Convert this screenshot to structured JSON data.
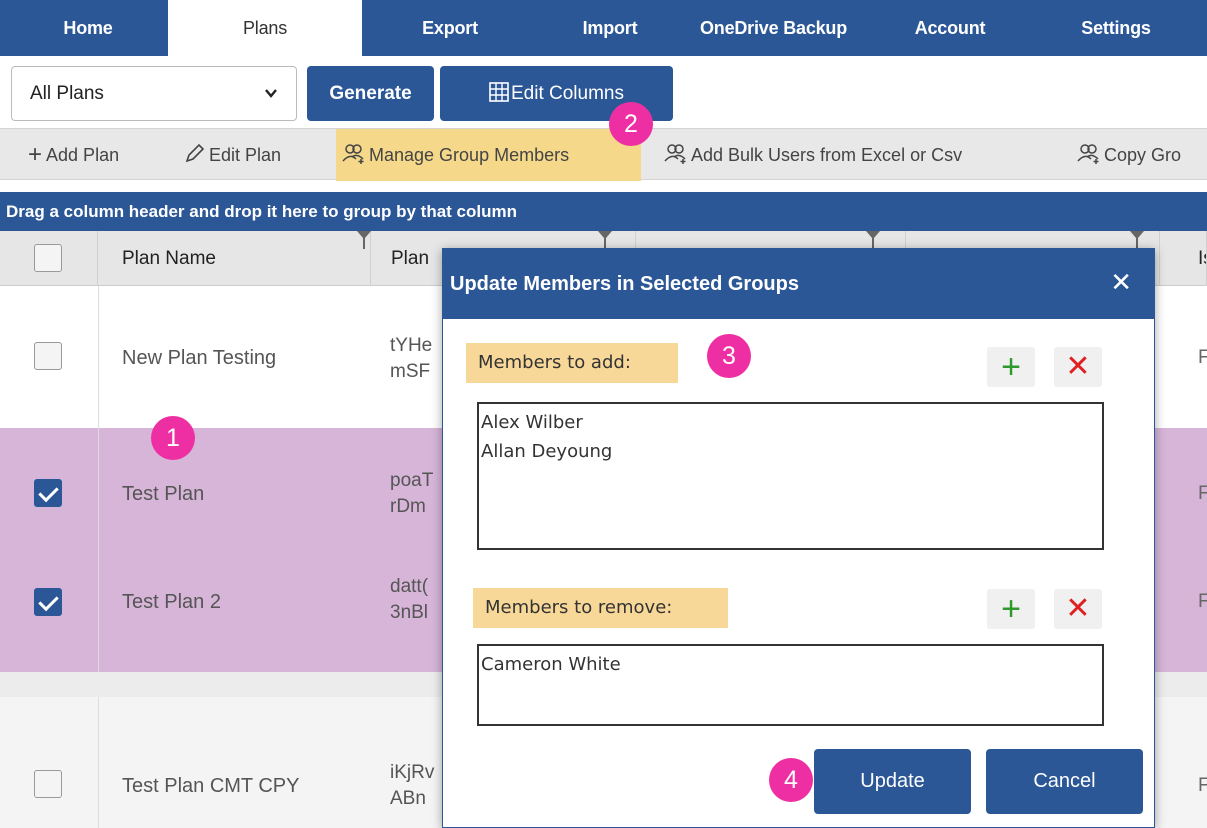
{
  "nav": {
    "tabs": [
      {
        "label": "Home"
      },
      {
        "label": "Plans"
      },
      {
        "label": "Export"
      },
      {
        "label": "Import"
      },
      {
        "label": "OneDrive Backup"
      },
      {
        "label": "Account"
      },
      {
        "label": "Settings"
      }
    ]
  },
  "toolbar": {
    "plan_filter": "All Plans",
    "generate": "Generate",
    "edit_columns": "Edit Columns"
  },
  "actions": {
    "add_plan": "Add Plan",
    "edit_plan": "Edit Plan",
    "manage_group_members": "Manage Group Members",
    "add_bulk_users": "Add Bulk Users from Excel or Csv",
    "copy_group": "Copy Gro"
  },
  "group_hint": "Drag a column header and drop it here to group by that column",
  "grid": {
    "columns": [
      "Plan Name",
      "Plan",
      "",
      "",
      "Is"
    ],
    "rows": [
      {
        "name": "New Plan Testing",
        "id_line1": "tYHe",
        "id_line2": "mSF",
        "last": "F",
        "checked": false
      },
      {
        "name": "Test Plan",
        "id_line1": "poaT",
        "id_line2": "rDm",
        "last": "F",
        "checked": true
      },
      {
        "name": "Test Plan 2",
        "id_line1": "datt(",
        "id_line2": "3nBl",
        "last": "F",
        "checked": true
      },
      {
        "name": "Test Plan CMT CPY",
        "id_line1": "iKjRv",
        "id_line2": "ABn",
        "last": "F",
        "checked": false
      }
    ]
  },
  "modal": {
    "title": "Update Members in Selected Groups",
    "close": "✕",
    "add_label": "Members to add:",
    "add_members": [
      "Alex Wilber",
      "Allan Deyoung"
    ],
    "remove_label": "Members to remove:",
    "remove_members": [
      "Cameron White"
    ],
    "plus": "+",
    "cross": "✕",
    "update": "Update",
    "cancel": "Cancel"
  },
  "callouts": [
    "1",
    "2",
    "3",
    "4"
  ],
  "colors": {
    "primary": "#2b5797",
    "highlight": "#f5d88a",
    "selected_row": "#d7b5d8",
    "callout": "#ee2fa3",
    "add_green": "#2e9a2e",
    "remove_red": "#e02020"
  }
}
